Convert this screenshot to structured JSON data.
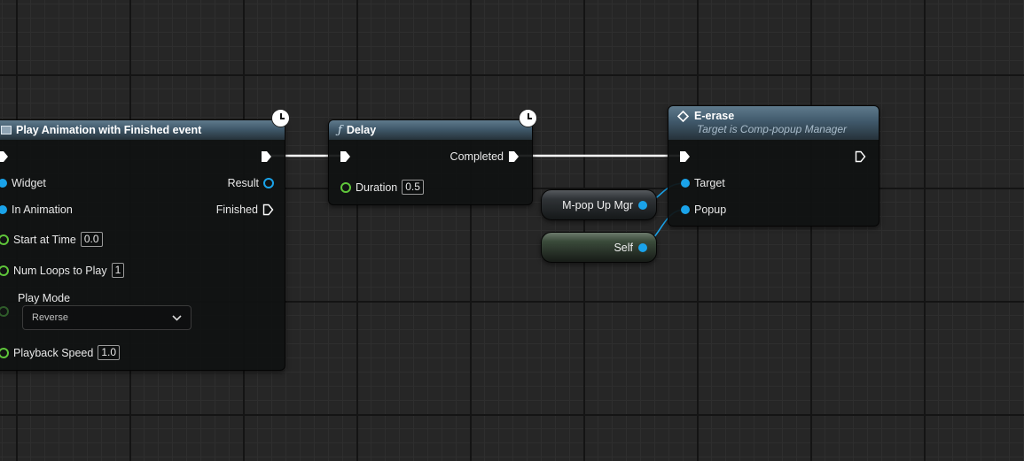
{
  "nodes": {
    "play_animation": {
      "title": "Play Animation with Finished event",
      "inputs": {
        "widget": "Widget",
        "in_animation": "In Animation",
        "start_at_time": "Start at Time",
        "start_at_time_value": "0.0",
        "num_loops": "Num Loops to Play",
        "num_loops_value": "1",
        "play_mode": "Play Mode",
        "play_mode_value": "Reverse",
        "playback_speed": "Playback Speed",
        "playback_speed_value": "1.0"
      },
      "outputs": {
        "result": "Result",
        "finished": "Finished"
      }
    },
    "delay": {
      "title": "Delay",
      "function_glyph": "ƒ",
      "duration": "Duration",
      "duration_value": "0.5",
      "completed": "Completed"
    },
    "erase": {
      "title": "E-erase",
      "subtitle": "Target is Comp-popup Manager",
      "target": "Target",
      "popup": "Popup"
    },
    "popup_mgr_var": {
      "label": "M-pop Up Mgr"
    },
    "self_var": {
      "label": "Self"
    }
  },
  "colors": {
    "exec_wire": "#ffffff",
    "object_pin": "#1aa3ea",
    "float_pin": "#5fc63a",
    "header": "#40596b"
  },
  "icons": {
    "clock": "clock-icon",
    "function": "function-icon",
    "event": "event-diamond-icon",
    "dropdown": "chevron-down-icon"
  }
}
